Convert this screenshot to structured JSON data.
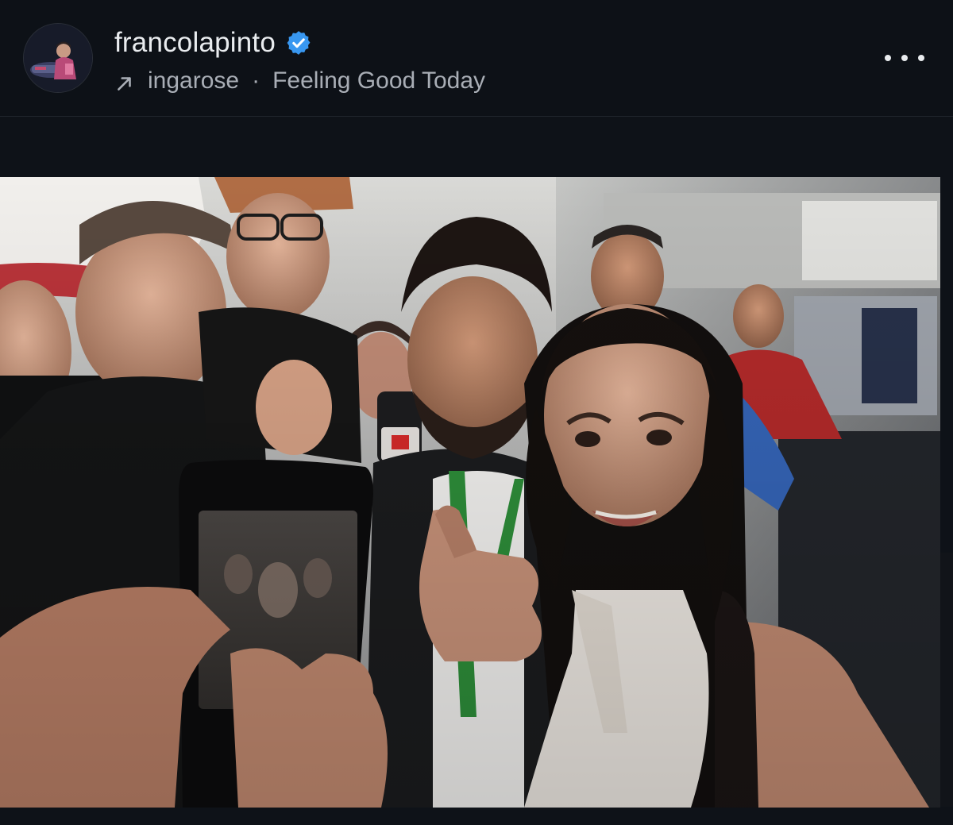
{
  "post": {
    "username": "francolapinto",
    "verified": true,
    "repost_from": "ingarose",
    "separator": "·",
    "song_title": "Feeling Good Today"
  },
  "icons": {
    "verified": "verified-badge-icon",
    "repost_arrow": "arrow-up-right-icon",
    "more": "more-options-icon"
  },
  "colors": {
    "background": "#0d1117",
    "text_primary": "#e9ecef",
    "text_secondary": "#a9aeb6",
    "verified_blue": "#3897f0"
  }
}
